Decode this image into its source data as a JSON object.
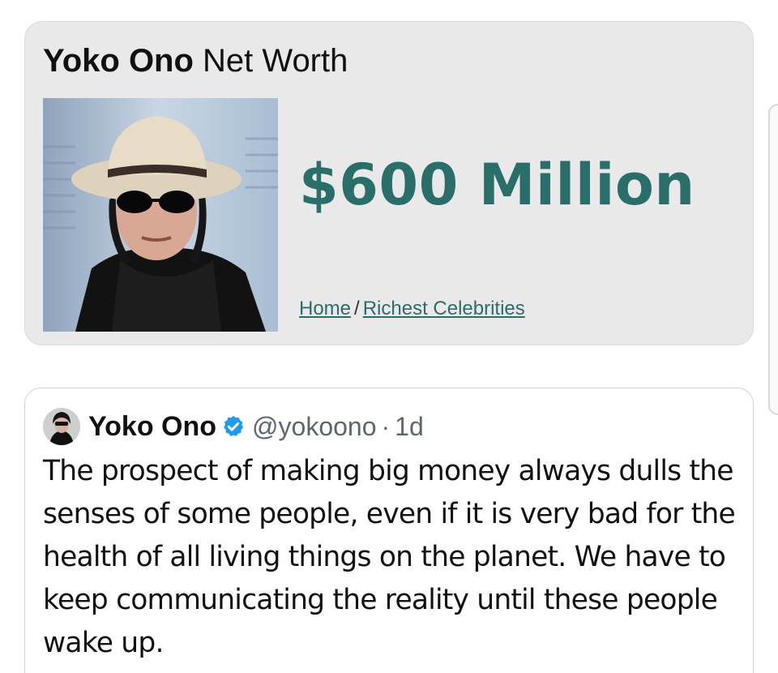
{
  "net_worth_card": {
    "title_name": "Yoko Ono",
    "title_suffix": "Net Worth",
    "amount": "$600 Million",
    "breadcrumb": {
      "home": "Home",
      "separator": "/",
      "category": "Richest Celebrities"
    }
  },
  "tweet": {
    "author_name": "Yoko Ono",
    "handle": "@yokoono",
    "separator": "·",
    "time": "1d",
    "verified_icon": "verified-badge-icon",
    "text": "The prospect of making big money always dulls the senses of some people, even if it is very bad for the health of all living things on the planet. We have to keep communicating the reality until these people wake up."
  },
  "colors": {
    "accent_teal": "#2a6e6a",
    "verified_blue": "#1d9bf0",
    "card_gray": "#e9e9e9"
  }
}
